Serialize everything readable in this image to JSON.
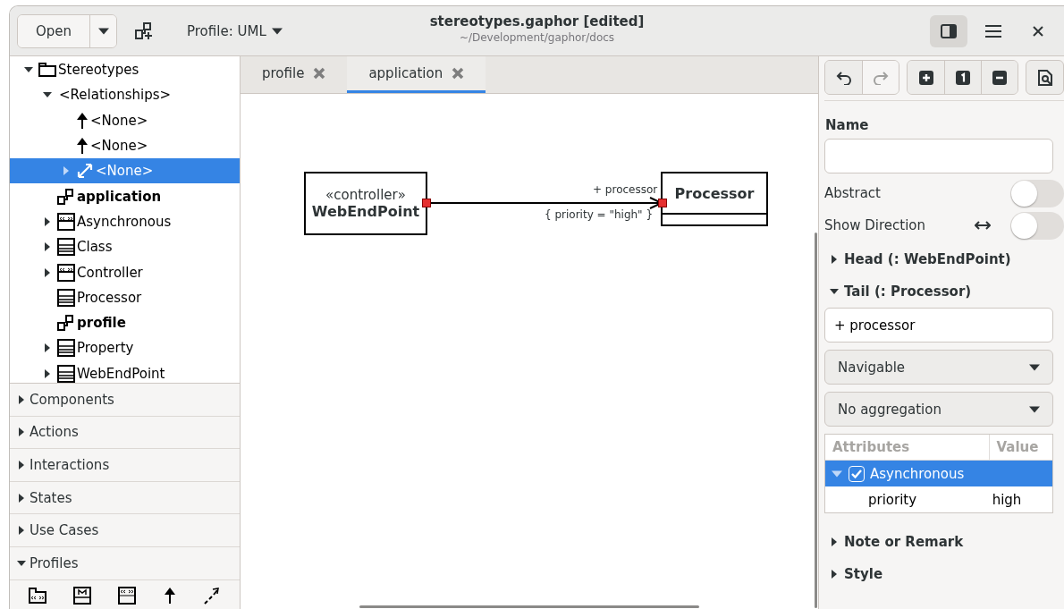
{
  "header": {
    "open_button": "Open",
    "profile_menu": "Profile: UML",
    "title": "stereotypes.gaphor [edited]",
    "subtitle": "~/Development/gaphor/docs"
  },
  "tree": [
    {
      "label": "Stereotypes",
      "kind": "package",
      "bold": false,
      "expanded": true,
      "selected": false,
      "children": [
        {
          "label": "<Relationships>",
          "kind": "folder",
          "bold": false,
          "expanded": true,
          "selected": false,
          "children": [
            {
              "label": "<None>",
              "kind": "generalization",
              "bold": false,
              "selected": false
            },
            {
              "label": "<None>",
              "kind": "generalization",
              "bold": false,
              "selected": false
            },
            {
              "label": "<None>",
              "kind": "association",
              "bold": false,
              "expanded": false,
              "selected": true
            }
          ]
        },
        {
          "label": "application",
          "kind": "diagram",
          "bold": true,
          "selected": false
        },
        {
          "label": "Asynchronous",
          "kind": "stereotype",
          "bold": false,
          "expanded": false,
          "selected": false
        },
        {
          "label": "Class",
          "kind": "class",
          "bold": false,
          "expanded": false,
          "selected": false
        },
        {
          "label": "Controller",
          "kind": "stereotype",
          "bold": false,
          "expanded": false,
          "selected": false
        },
        {
          "label": "Processor",
          "kind": "class",
          "bold": false,
          "selected": false
        },
        {
          "label": "profile",
          "kind": "diagram",
          "bold": true,
          "selected": false
        },
        {
          "label": "Property",
          "kind": "class",
          "bold": false,
          "expanded": false,
          "selected": false
        },
        {
          "label": "WebEndPoint",
          "kind": "class",
          "bold": false,
          "expanded": false,
          "selected": false
        }
      ]
    }
  ],
  "toolbox": [
    {
      "label": "Components",
      "expanded": false
    },
    {
      "label": "Actions",
      "expanded": false
    },
    {
      "label": "Interactions",
      "expanded": false
    },
    {
      "label": "States",
      "expanded": false
    },
    {
      "label": "Use Cases",
      "expanded": false
    },
    {
      "label": "Profiles",
      "expanded": true
    }
  ],
  "tabs": [
    {
      "label": "profile",
      "selected": false
    },
    {
      "label": "application",
      "selected": true
    }
  ],
  "diagram": {
    "source": {
      "stereotype": "«controller»",
      "name": "WebEndPoint"
    },
    "target": {
      "name": "Processor"
    },
    "end_name": "+ processor",
    "constraint": "{ priority = \"high\" }"
  },
  "editor": {
    "name_label": "Name",
    "toggles": [
      {
        "label": "Abstract",
        "on": false,
        "kind": "plain"
      },
      {
        "label": "Show Direction",
        "on": false,
        "kind": "direction"
      }
    ],
    "head": {
      "label": "Head (: WebEndPoint)",
      "expanded": false
    },
    "tail": {
      "label": "Tail (: Processor)",
      "expanded": true
    },
    "tail_name": "+ processor",
    "navigability": "Navigable",
    "aggregation": "No aggregation",
    "attributes": {
      "columns": [
        "Attributes",
        "Value"
      ],
      "rows": [
        {
          "name": "Asynchronous",
          "checked": true,
          "expanded": true,
          "selected": true,
          "children": [
            {
              "name": "priority",
              "value": "high"
            }
          ]
        }
      ]
    },
    "sections": [
      {
        "label": "Note or Remark",
        "expanded": false
      },
      {
        "label": "Style",
        "expanded": false
      }
    ]
  }
}
